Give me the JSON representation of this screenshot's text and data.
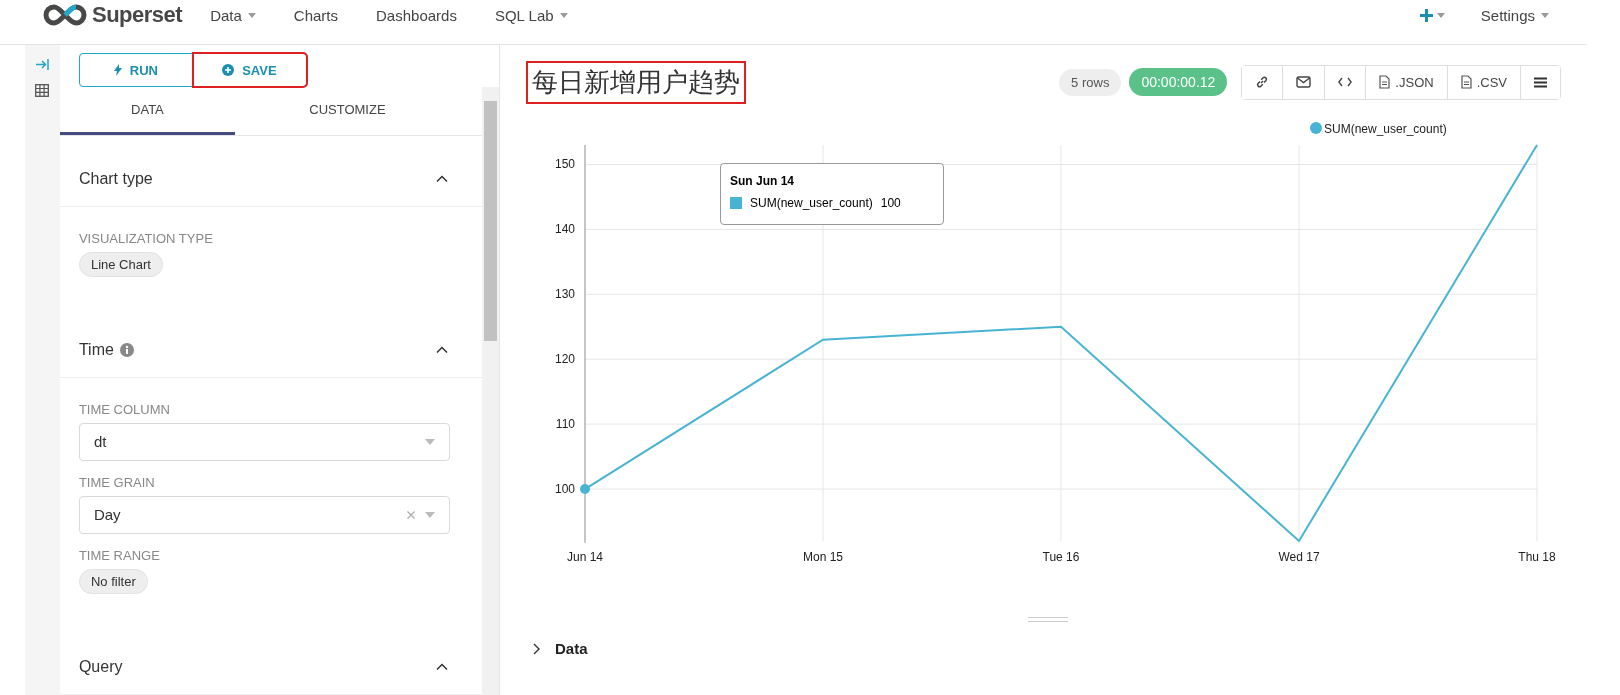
{
  "nav": {
    "brand": "Superset",
    "menu": [
      {
        "label": "Data",
        "dropdown": true
      },
      {
        "label": "Charts",
        "dropdown": false
      },
      {
        "label": "Dashboards",
        "dropdown": false
      },
      {
        "label": "SQL Lab",
        "dropdown": true
      }
    ],
    "settings": {
      "label": "Settings",
      "dropdown": true
    }
  },
  "explore": {
    "actions": [
      {
        "kind": "run",
        "label": "RUN",
        "highlighted": false
      },
      {
        "kind": "save",
        "label": "SAVE",
        "highlighted": true
      }
    ],
    "tabs": [
      {
        "label": "DATA",
        "selected": true
      },
      {
        "label": "CUSTOMIZE",
        "selected": false
      }
    ],
    "sections": [
      {
        "title": "Chart type",
        "info": false,
        "expanded": true,
        "controls": [
          {
            "kind": "pill",
            "label": "VISUALIZATION TYPE",
            "value": "Line Chart"
          }
        ]
      },
      {
        "title": "Time",
        "info": true,
        "expanded": true,
        "controls": [
          {
            "kind": "select",
            "label": "TIME COLUMN",
            "value": "dt",
            "clearable": false
          },
          {
            "kind": "select",
            "label": "TIME GRAIN",
            "value": "Day",
            "clearable": true
          },
          {
            "kind": "pill",
            "label": "TIME RANGE",
            "value": "No filter"
          }
        ]
      },
      {
        "title": "Query",
        "info": false,
        "expanded": true
      }
    ]
  },
  "chart": {
    "title": "每日新增用户趋势",
    "title_highlighted": true,
    "row_count": "5 rows",
    "timer": "00:00:00.12",
    "actions": [
      {
        "kind": "link"
      },
      {
        "kind": "email"
      },
      {
        "kind": "embed"
      },
      {
        "kind": "json",
        "label": ".JSON"
      },
      {
        "kind": "csv",
        "label": ".CSV"
      },
      {
        "kind": "menu"
      }
    ],
    "points": [
      {
        "selected": true
      },
      {
        "selected": false
      },
      {
        "selected": false
      },
      {
        "selected": false
      },
      {
        "selected": false
      }
    ],
    "tooltip": {
      "title": "Sun Jun 14",
      "series": "SUM(new_user_count)",
      "value": "100"
    },
    "chart_data": {
      "type": "line",
      "categories": [
        "Jun 14",
        "Mon 15",
        "Tue 16",
        "Wed 17",
        "Thu 18"
      ],
      "series": [
        {
          "name": "SUM(new_user_count)",
          "color": "#48b4d4",
          "values": [
            100,
            123,
            125,
            92,
            153
          ]
        }
      ],
      "grid": true,
      "ylim": [
        92,
        153
      ],
      "yticks": [
        100,
        110,
        120,
        130,
        140,
        150
      ]
    },
    "data_pane": {
      "label": "Data",
      "expanded": false
    }
  }
}
